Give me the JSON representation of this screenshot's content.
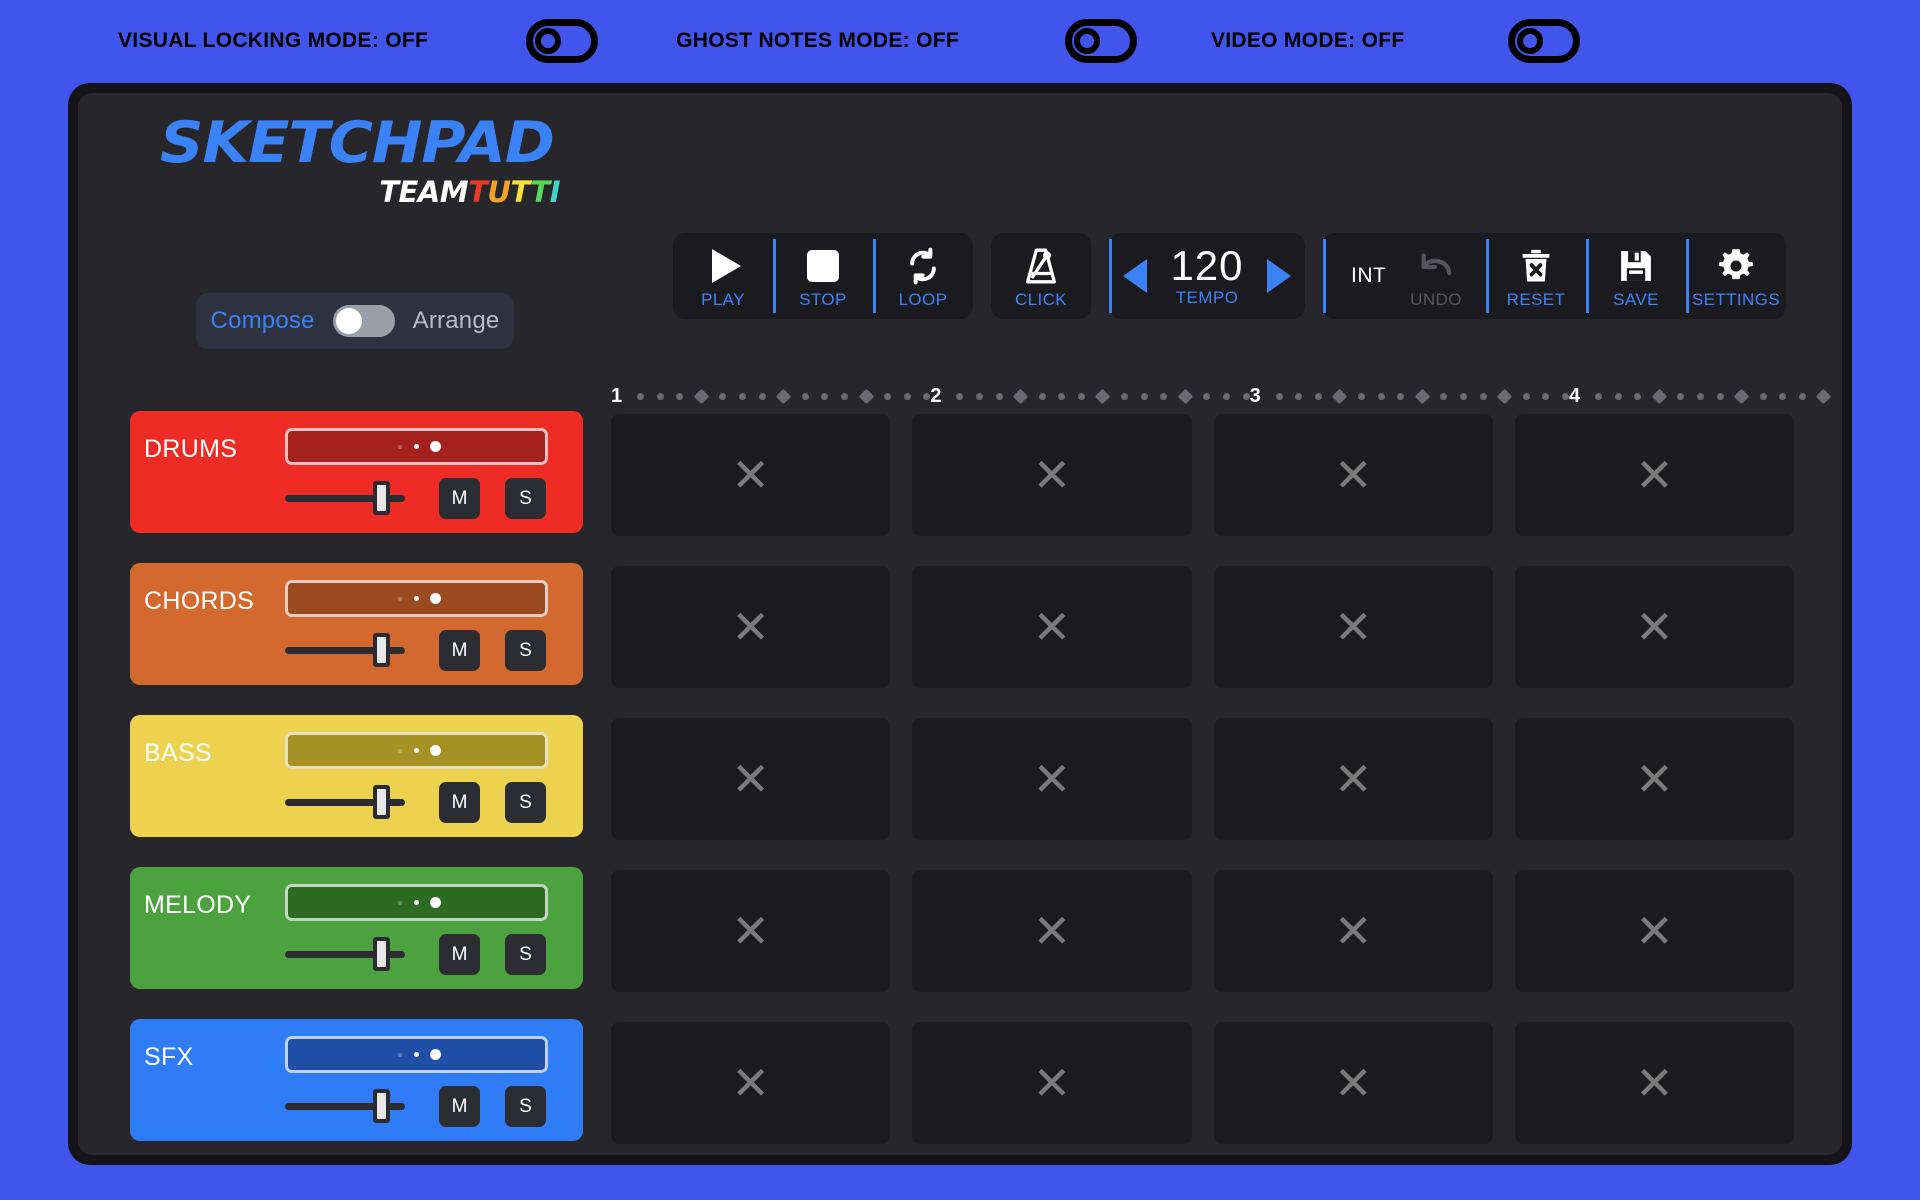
{
  "top_bar": {
    "modes": [
      {
        "label": "VISUAL LOCKING MODE: OFF",
        "state": "off",
        "icon": "toggle-off-icon"
      },
      {
        "label": "GHOST NOTES MODE: OFF",
        "state": "off",
        "icon": "toggle-off-icon"
      },
      {
        "label": "VIDEO MODE: OFF",
        "state": "off",
        "icon": "toggle-off-icon"
      }
    ]
  },
  "logo": {
    "main": "SKETCHPAD",
    "team": "TEAM",
    "tutti_letters": [
      "T",
      "U",
      "T",
      "T",
      "I"
    ],
    "tutti_colors": [
      "#e8392b",
      "#f0a324",
      "#f5e13a",
      "#5bd85b",
      "#3ed6c8"
    ],
    "main_color": "#3b82f6"
  },
  "transport": {
    "play": {
      "label": "PLAY",
      "icon": "play-icon"
    },
    "stop": {
      "label": "STOP",
      "icon": "stop-icon"
    },
    "loop": {
      "label": "LOOP",
      "icon": "loop-icon"
    },
    "click": {
      "label": "CLICK",
      "icon": "metronome-icon"
    },
    "tempo": {
      "value": "120",
      "label": "TEMPO",
      "dec_icon": "arrow-left-icon",
      "inc_icon": "arrow-right-icon"
    },
    "section": {
      "value": "INTRO",
      "icon": "chevron-down-icon"
    }
  },
  "actions": {
    "undo": {
      "label": "UNDO",
      "icon": "undo-icon",
      "disabled": true
    },
    "reset": {
      "label": "RESET",
      "icon": "trash-icon",
      "disabled": false
    },
    "save": {
      "label": "SAVE",
      "icon": "floppy-disk-icon",
      "disabled": false
    },
    "settings": {
      "label": "SETTINGS",
      "icon": "gear-icon",
      "disabled": false
    }
  },
  "view_toggle": {
    "left_label": "Compose",
    "right_label": "Arrange",
    "active": "Compose",
    "knob_position": "left"
  },
  "tracks": [
    {
      "name": "DRUMS",
      "color": "#ef2b26",
      "pad_color": "#a5211d",
      "volume": 73,
      "mute": "M",
      "solo": "S"
    },
    {
      "name": "CHORDS",
      "color": "#d4692f",
      "pad_color": "#9a4a20",
      "volume": 73,
      "mute": "M",
      "solo": "S"
    },
    {
      "name": "BASS",
      "color": "#ecd24e",
      "pad_color": "#a69125",
      "volume": 73,
      "mute": "M",
      "solo": "S"
    },
    {
      "name": "MELODY",
      "color": "#4ba23f",
      "pad_color": "#2d6b22",
      "volume": 73,
      "mute": "M",
      "solo": "S"
    },
    {
      "name": "SFX",
      "color": "#2f7cf6",
      "pad_color": "#1f4fa6",
      "volume": 73,
      "mute": "M",
      "solo": "S"
    }
  ],
  "grid": {
    "bars": [
      "1",
      "2",
      "3",
      "4"
    ],
    "ticks_per_bar": 15,
    "beat_tick_indices": [
      3,
      7,
      11
    ],
    "empty_clip_icon": "x-icon",
    "rows": [
      {
        "track": "DRUMS",
        "clips": [
          "empty",
          "empty",
          "empty",
          "empty"
        ]
      },
      {
        "track": "CHORDS",
        "clips": [
          "empty",
          "empty",
          "empty",
          "empty"
        ]
      },
      {
        "track": "BASS",
        "clips": [
          "empty",
          "empty",
          "empty",
          "empty"
        ]
      },
      {
        "track": "MELODY",
        "clips": [
          "empty",
          "empty",
          "empty",
          "empty"
        ]
      },
      {
        "track": "SFX",
        "clips": [
          "empty",
          "empty",
          "empty",
          "empty"
        ]
      }
    ]
  },
  "theme": {
    "page_bg": "#4154ec",
    "frame_bg": "#141417",
    "app_bg": "#26262b",
    "panel_bg": "#1b1b1f",
    "accent": "#3b82f6",
    "clip_bg": "#1b1b1d"
  }
}
